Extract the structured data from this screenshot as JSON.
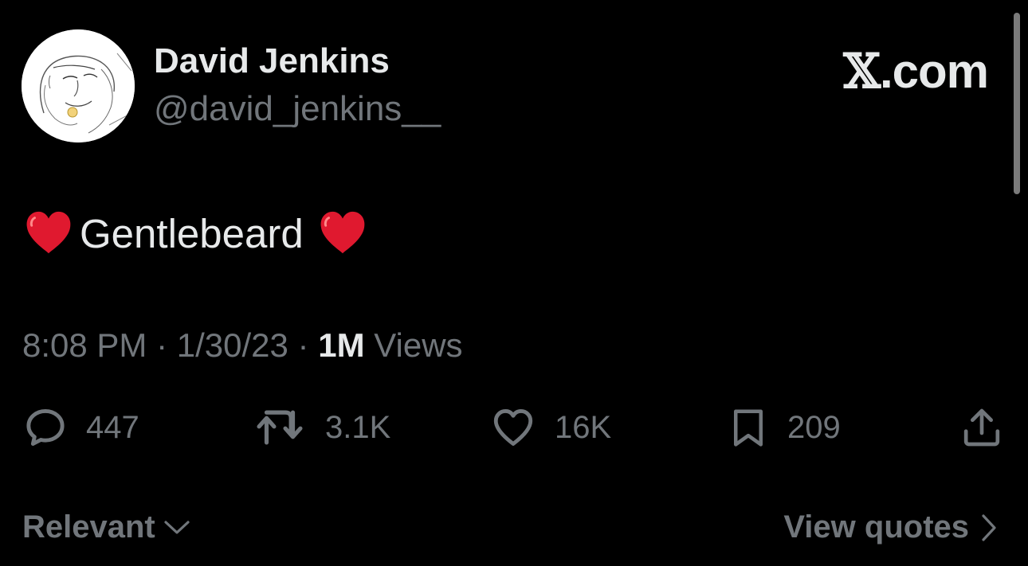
{
  "author": {
    "display_name": "David Jenkins",
    "handle": "@david_jenkins__",
    "avatar": "sketch-portrait-avatar"
  },
  "brand": {
    "x_mark": "𝕏",
    "suffix": ".com"
  },
  "tweet": {
    "text": "Gentlebeard",
    "leading_emoji": "red-heart-emoji",
    "trailing_emoji": "red-heart-emoji"
  },
  "meta": {
    "time": "8:08 PM",
    "separator": " · ",
    "date": "1/30/23",
    "views_count": "1M",
    "views_label": " Views"
  },
  "actions": {
    "replies": {
      "icon": "reply-icon",
      "count": "447"
    },
    "reposts": {
      "icon": "retweet-icon",
      "count": "3.1K"
    },
    "likes": {
      "icon": "heart-icon",
      "count": "16K"
    },
    "bookmarks": {
      "icon": "bookmark-icon",
      "count": "209"
    },
    "share": {
      "icon": "share-icon"
    }
  },
  "footer": {
    "sort_label": "Relevant",
    "view_quotes_label": "View quotes"
  },
  "colors": {
    "background": "#000000",
    "primary_text": "#e7e9ea",
    "secondary_text": "#71767b",
    "heart_red": "#e0192f"
  }
}
